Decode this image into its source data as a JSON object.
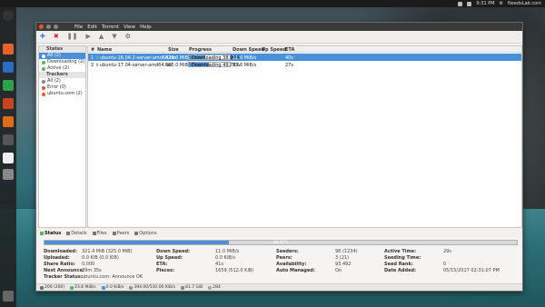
{
  "panel": {
    "time": "9:31 PM",
    "brand": "NeedsLab.com"
  },
  "window": {
    "menus": [
      "File",
      "Edit",
      "Torrent",
      "View",
      "Help"
    ]
  },
  "toolbar": {
    "icons": [
      "add-icon",
      "remove-icon",
      "pause-icon",
      "resume-icon",
      "queue-up-icon",
      "queue-down-icon",
      "preferences-icon"
    ]
  },
  "sidebar": {
    "states_header": "States",
    "states": [
      {
        "label": "All (2)",
        "color": "#4a90d9"
      },
      {
        "label": "Downloading (2)",
        "color": "#5cb85c"
      },
      {
        "label": "Active (2)",
        "color": "#5cb85c"
      }
    ],
    "trackers_header": "Trackers",
    "trackers": [
      {
        "label": "All (2)",
        "color": "#888888"
      },
      {
        "label": "Error (0)",
        "color": "#d9534f"
      },
      {
        "label": "ubuntu.com (2)",
        "color": "#e95420"
      }
    ]
  },
  "columns": {
    "num": "#",
    "name": "Name",
    "size": "Size",
    "progress": "Progress",
    "down": "Down Speed",
    "up": "Up Speed",
    "eta": "ETA"
  },
  "torrents": [
    {
      "num": "1",
      "name": "ubuntu-16.04.2-server-amd64.iso",
      "size": "829.0 MiB",
      "progress_text": "Downloading 38.96%",
      "progress": 0.3896,
      "down": "11.0 MiB/s",
      "up": "",
      "eta": "40s"
    },
    {
      "num": "2",
      "name": "ubuntu-17.04-server-amd64.iso",
      "size": "685.0 MiB",
      "progress_text": "Downloading 49.78%",
      "progress": 0.4978,
      "down": "12.6 MiB/s",
      "up": "",
      "eta": "27s"
    }
  ],
  "tabs": [
    "Status",
    "Details",
    "Files",
    "Peers",
    "Options"
  ],
  "details": {
    "progress_text": "38.97%",
    "progress": 0.3897,
    "col1": {
      "downloaded_label": "Downloaded:",
      "downloaded": "321.4 MiB (325.0 MiB)",
      "uploaded_label": "Uploaded:",
      "uploaded": "0.0 KiB (0.0 KiB)",
      "share_label": "Share Ratio:",
      "share": "0.000",
      "announce_label": "Next Announce:",
      "announce": "29m 35s",
      "tracker_label": "Tracker Status:",
      "tracker": "ubuntu.com: Announce OK"
    },
    "col2": {
      "downspeed_label": "Down Speed:",
      "downspeed": "11.0 MiB/s",
      "upspeed_label": "Up Speed:",
      "upspeed": "0.0 KiB/s",
      "eta_label": "ETA:",
      "eta": "41s",
      "pieces_label": "Pieces:",
      "pieces": "1659 (512.0 KiB)"
    },
    "col3": {
      "seeders_label": "Seeders:",
      "seeders": "98 (1234)",
      "peers_label": "Peers:",
      "peers": "3 (21)",
      "availability_label": "Availability:",
      "availability": "93.492",
      "managed_label": "Auto Managed:",
      "managed": "On"
    },
    "col4": {
      "active_label": "Active Time:",
      "active": "29s",
      "seeding_label": "Seeding Time:",
      "seeding": "",
      "rank_label": "Seed Rank:",
      "rank": "0",
      "added_label": "Date Added:",
      "added": "05/15/2017 02:31:07 PM"
    }
  },
  "statusbar": {
    "connections": "200 (200)",
    "down": "23.6 MiB/s",
    "up": "0.0 KiB/s",
    "protocol": "394.00/530.00 KiB/s",
    "disk": "81.7 GiB",
    "dht": "284"
  }
}
